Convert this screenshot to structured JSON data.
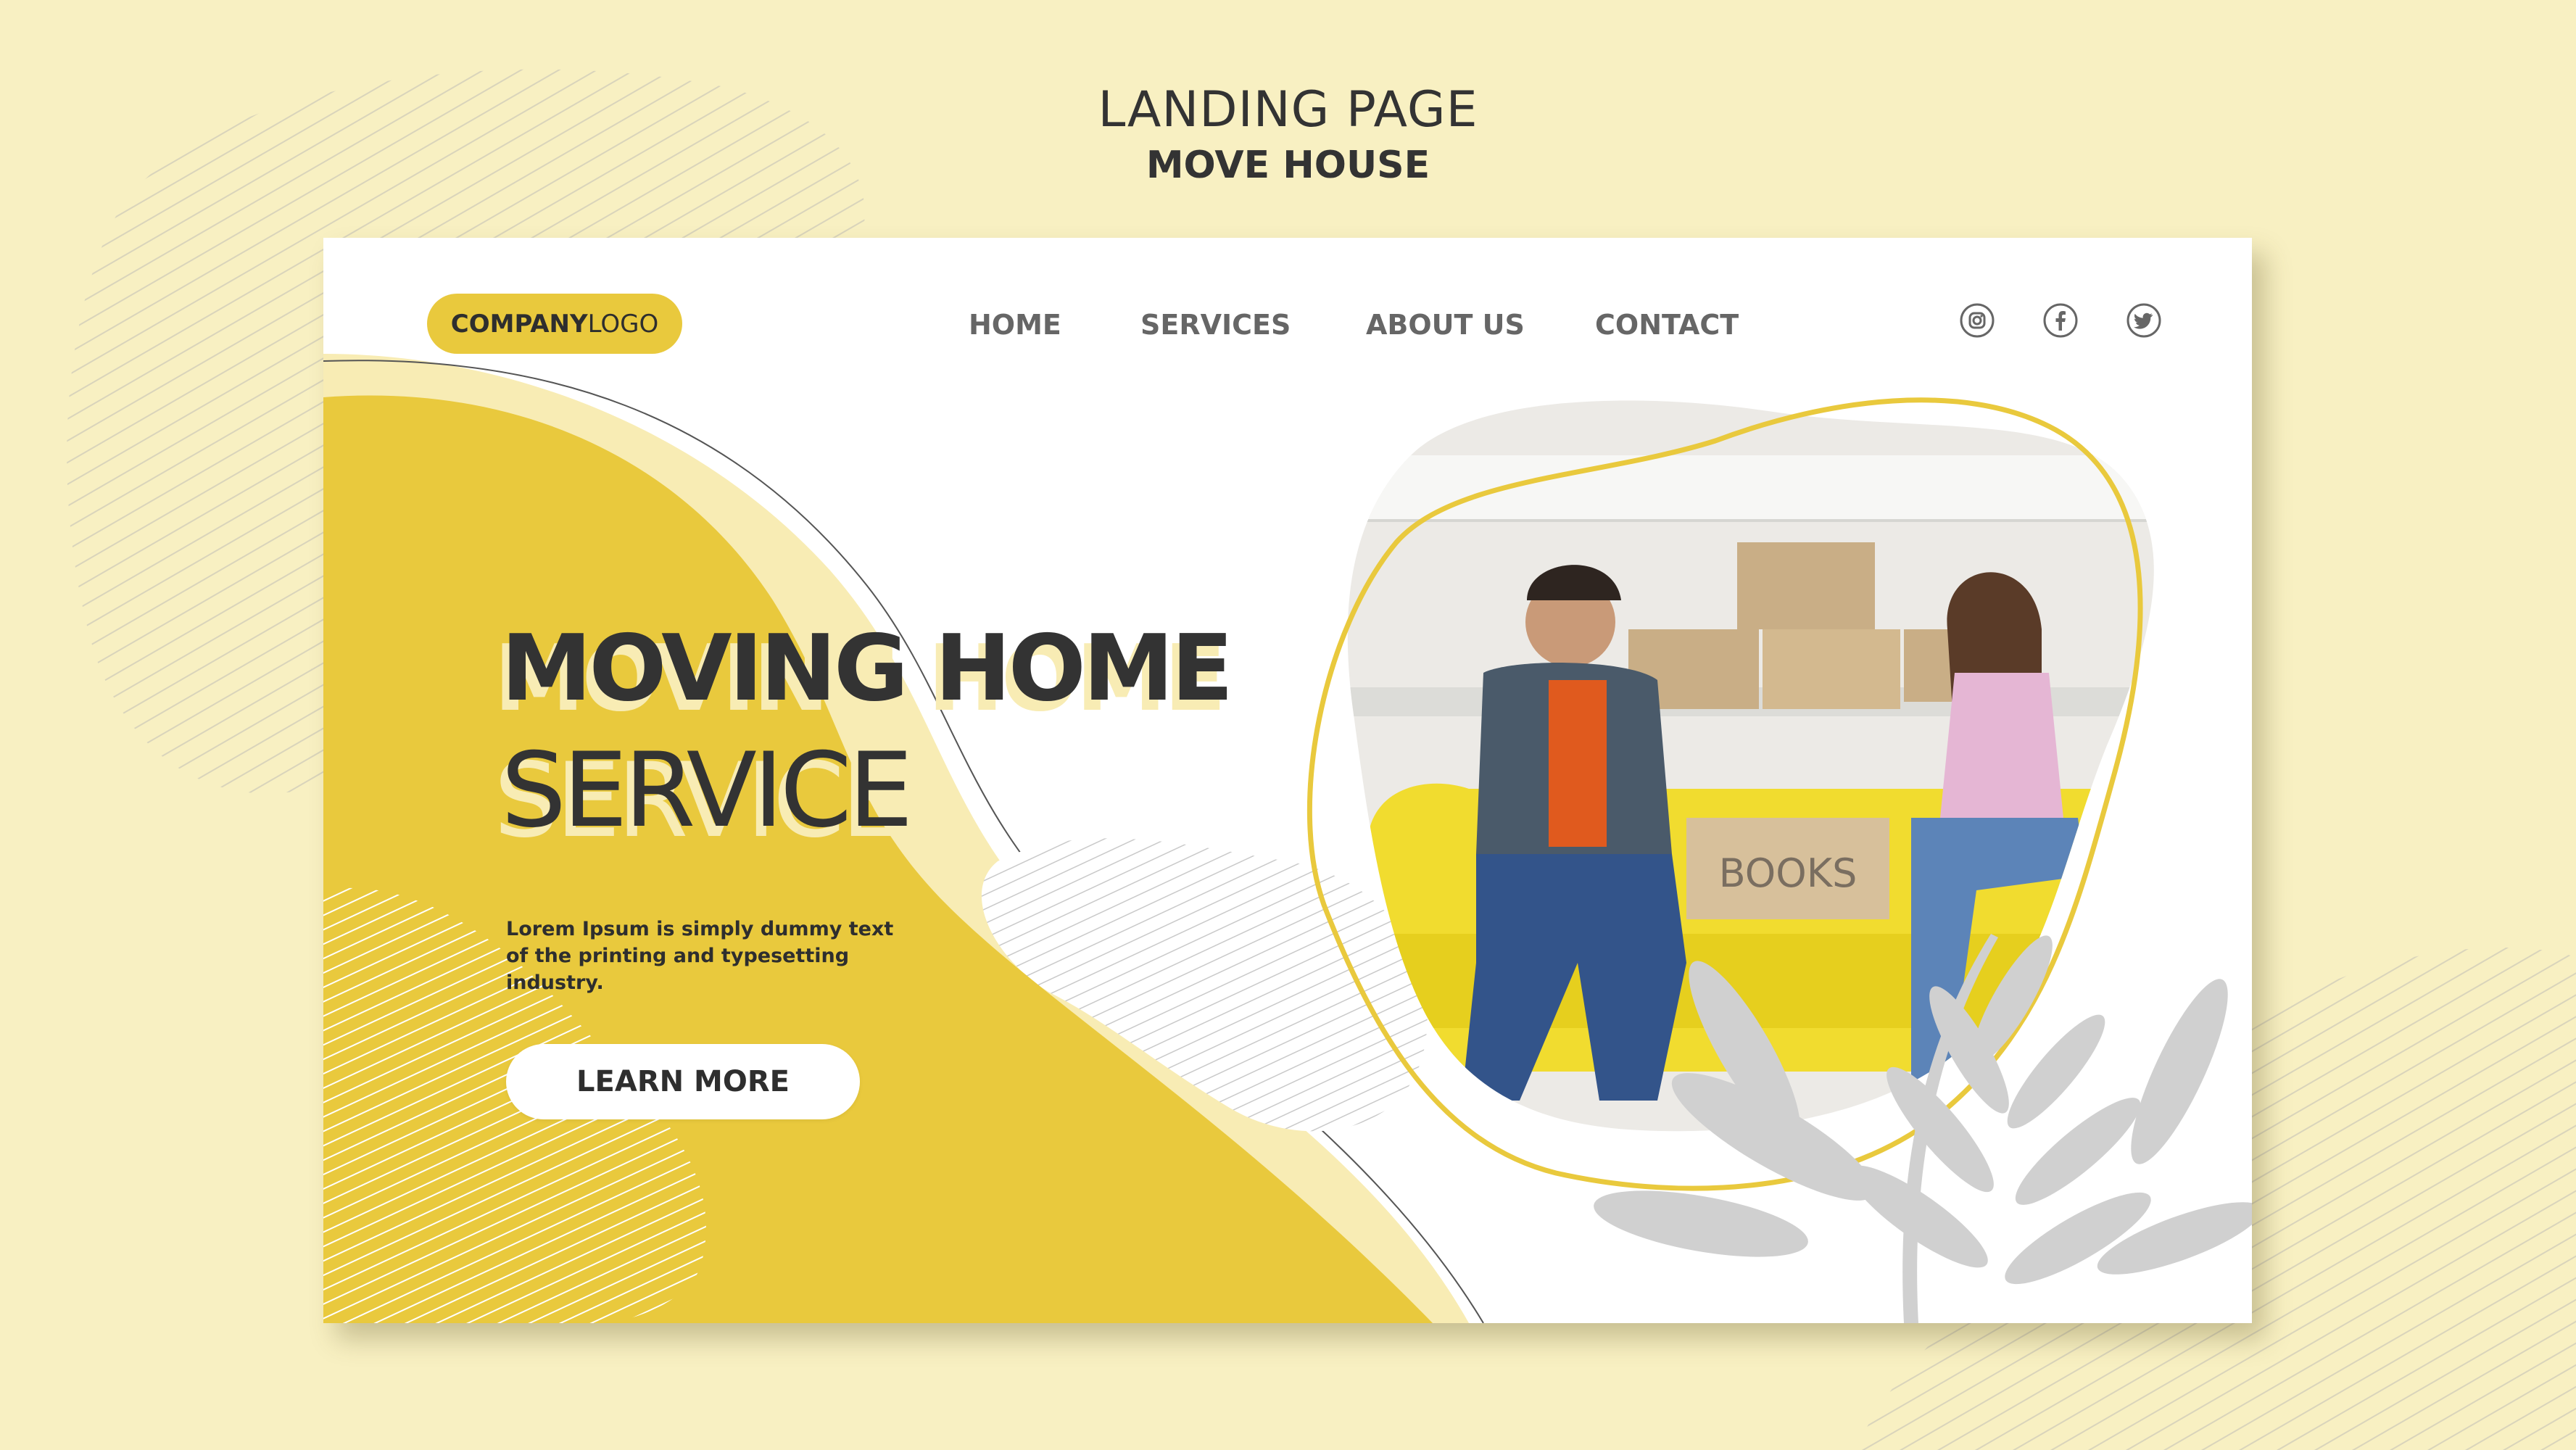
{
  "caption": {
    "title": "LANDING PAGE",
    "subtitle": "MOVE HOUSE"
  },
  "header": {
    "logo_bold": "COMPANY",
    "logo_light": "LOGO",
    "nav": [
      {
        "label": "HOME"
      },
      {
        "label": "SERVICES"
      },
      {
        "label": "ABOUT US"
      },
      {
        "label": "CONTACT"
      }
    ],
    "social_icons": [
      "instagram-icon",
      "facebook-icon",
      "twitter-icon"
    ]
  },
  "hero": {
    "headline_line1": "MOVING HOME",
    "headline_line2": "SERVICE",
    "description": "Lorem Ipsum is simply dummy text of the printing and typesetting industry.",
    "cta_label": "LEARN MORE",
    "photo_box_label": "BOOKS"
  },
  "colors": {
    "background": "#f8f0c2",
    "accent_yellow": "#e9c93d",
    "light_yellow": "#f8ecb4",
    "text_dark": "#333333",
    "nav_gray": "#666666",
    "card": "#ffffff",
    "leaf_gray": "#cfcfcf"
  }
}
